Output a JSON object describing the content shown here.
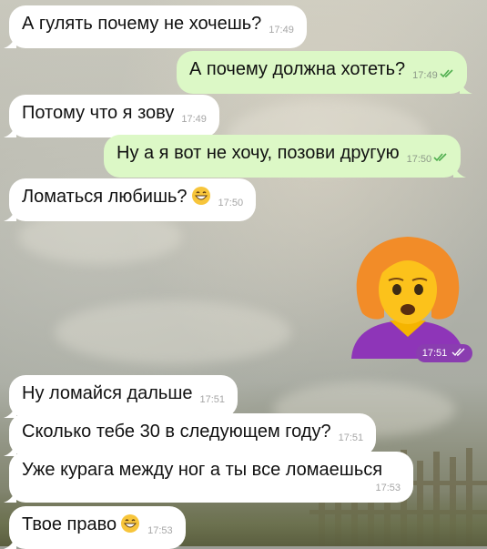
{
  "messages": [
    {
      "dir": "in",
      "text": "А гулять почему не хочешь?",
      "time": "17:49"
    },
    {
      "dir": "out",
      "text": "А почему должна хотеть?",
      "time": "17:49"
    },
    {
      "dir": "in",
      "text": "Потому что я зову",
      "time": "17:49"
    },
    {
      "dir": "out",
      "text": "Ну а я вот не хочу, позови другую",
      "time": "17:50"
    },
    {
      "dir": "in",
      "text": "Ломаться любишь?",
      "time": "17:50",
      "emoji": "grinning-face-emoji"
    },
    {
      "dir": "out",
      "sticker": "woman-pouting-emoji-sticker",
      "time": "17:51"
    },
    {
      "dir": "in",
      "text": "Ну ломайся дальше",
      "time": "17:51"
    },
    {
      "dir": "in",
      "text": "Сколько тебе 30 в следующем году?",
      "time": "17:51"
    },
    {
      "dir": "in",
      "text": "Уже курага между ног а ты все ломаешься",
      "time": "17:53"
    },
    {
      "dir": "in",
      "text": "Твое право",
      "time": "17:53",
      "emoji": "grinning-face-emoji"
    }
  ],
  "colors": {
    "incoming": "#ffffff",
    "outgoing": "#dcf8c6",
    "sticker_time_bg": "#8a3db0",
    "read_check": "#4fae4e"
  }
}
